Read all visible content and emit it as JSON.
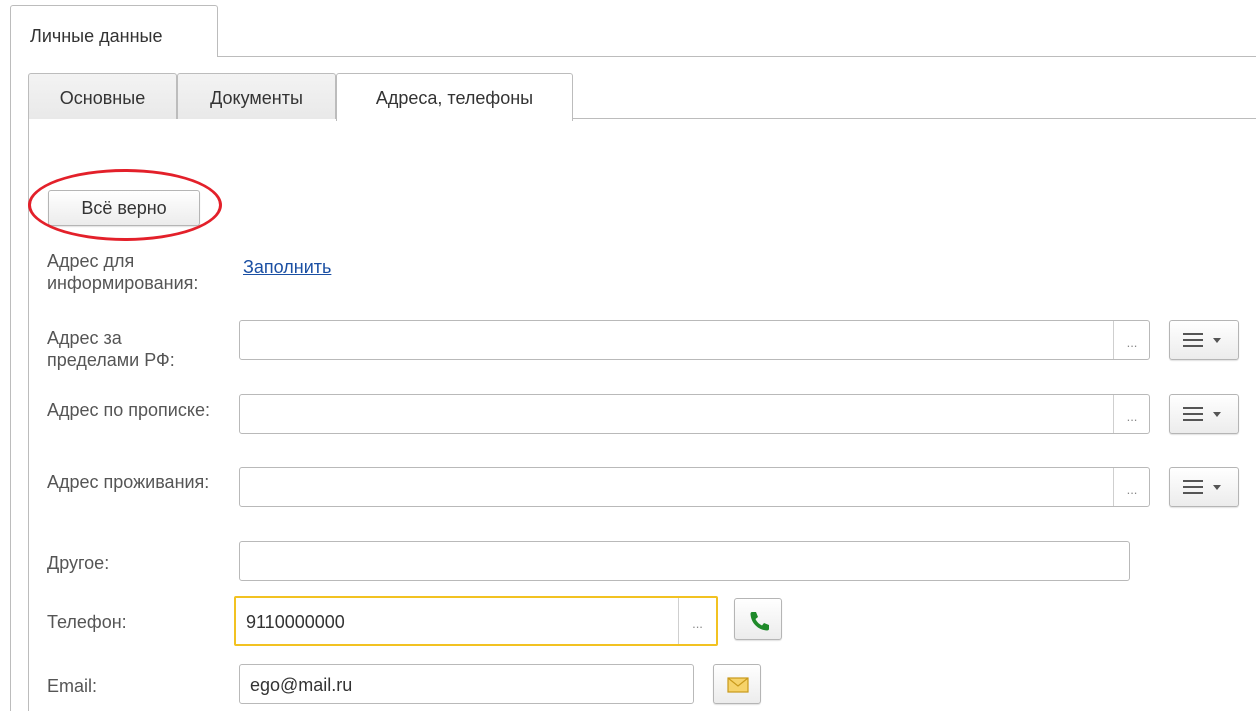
{
  "tabs": {
    "outer": "Личные данные",
    "inner": [
      "Основные",
      "Документы",
      "Адреса, телефоны"
    ]
  },
  "confirm_button": "Всё верно",
  "info_address": {
    "label": "Адрес для информирования:",
    "fill_link": "Заполнить"
  },
  "fields": {
    "address_abroad": {
      "label": "Адрес за пределами РФ:",
      "value": ""
    },
    "address_registration": {
      "label": "Адрес по прописке:",
      "value": ""
    },
    "address_residence": {
      "label": "Адрес проживания:",
      "value": ""
    },
    "other": {
      "label": "Другое:",
      "value": ""
    },
    "phone": {
      "label": "Телефон:",
      "value": "9110000000"
    },
    "email": {
      "label": "Email:",
      "value": "ego@mail.ru"
    }
  },
  "dots_label": "...",
  "icons": {
    "menu": "hamburger-menu-icon",
    "call": "phone-icon",
    "mail": "envelope-icon"
  },
  "colors": {
    "highlight": "#e3202a",
    "focus_border": "#f2c221",
    "link": "#1a4fa3",
    "phone_icon": "#1f8a2a",
    "mail_icon": "#f1c232"
  }
}
